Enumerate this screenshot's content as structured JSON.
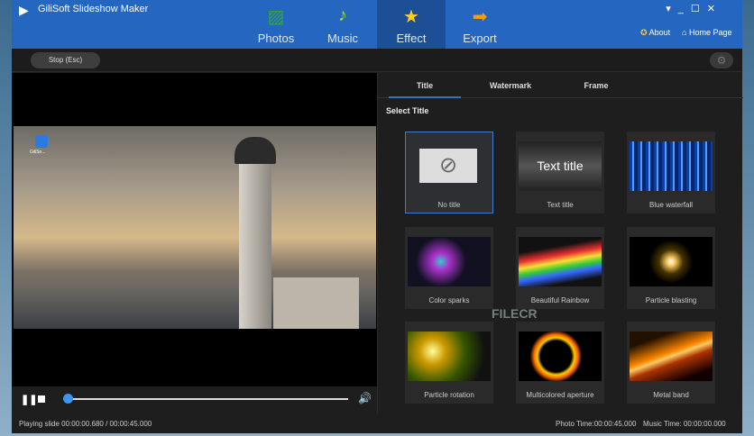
{
  "app": {
    "title": "GiliSoft Slideshow Maker",
    "window_controls": [
      "▾",
      "_",
      "☐",
      "✕"
    ]
  },
  "nav": [
    {
      "label": "Photos",
      "icon": "photos-icon"
    },
    {
      "label": "Music",
      "icon": "music-note-icon"
    },
    {
      "label": "Effect",
      "icon": "magic-wand-star-icon",
      "active": true
    },
    {
      "label": "Export",
      "icon": "arrow-right-icon"
    }
  ],
  "links": {
    "about": "About",
    "home": "Home Page"
  },
  "toolbar": {
    "stop": "Stop (Esc)"
  },
  "preview": {
    "desktop_icon_label": "GiliSo..."
  },
  "player": {
    "progress": 0.015
  },
  "status": {
    "playing": "Playing slide  00:00:00.680 / 00:00:45.000",
    "photo_time": "Photo Time:00:00:45.000",
    "music_time": "Music Time:  00:00:00.000"
  },
  "panel": {
    "tabs": [
      "Title",
      "Watermark",
      "Frame"
    ],
    "active_tab": "Title",
    "section": "Select Title",
    "titles": [
      {
        "label": "No title"
      },
      {
        "label": "Text title",
        "preview": "Text title"
      },
      {
        "label": "Blue waterfall"
      },
      {
        "label": "Color sparks"
      },
      {
        "label": "Beautiful Rainbow"
      },
      {
        "label": "Particle blasting"
      },
      {
        "label": "Particle rotation"
      },
      {
        "label": "Multicolored aperture"
      },
      {
        "label": "Metal band"
      }
    ]
  },
  "watermark": "FILECR"
}
